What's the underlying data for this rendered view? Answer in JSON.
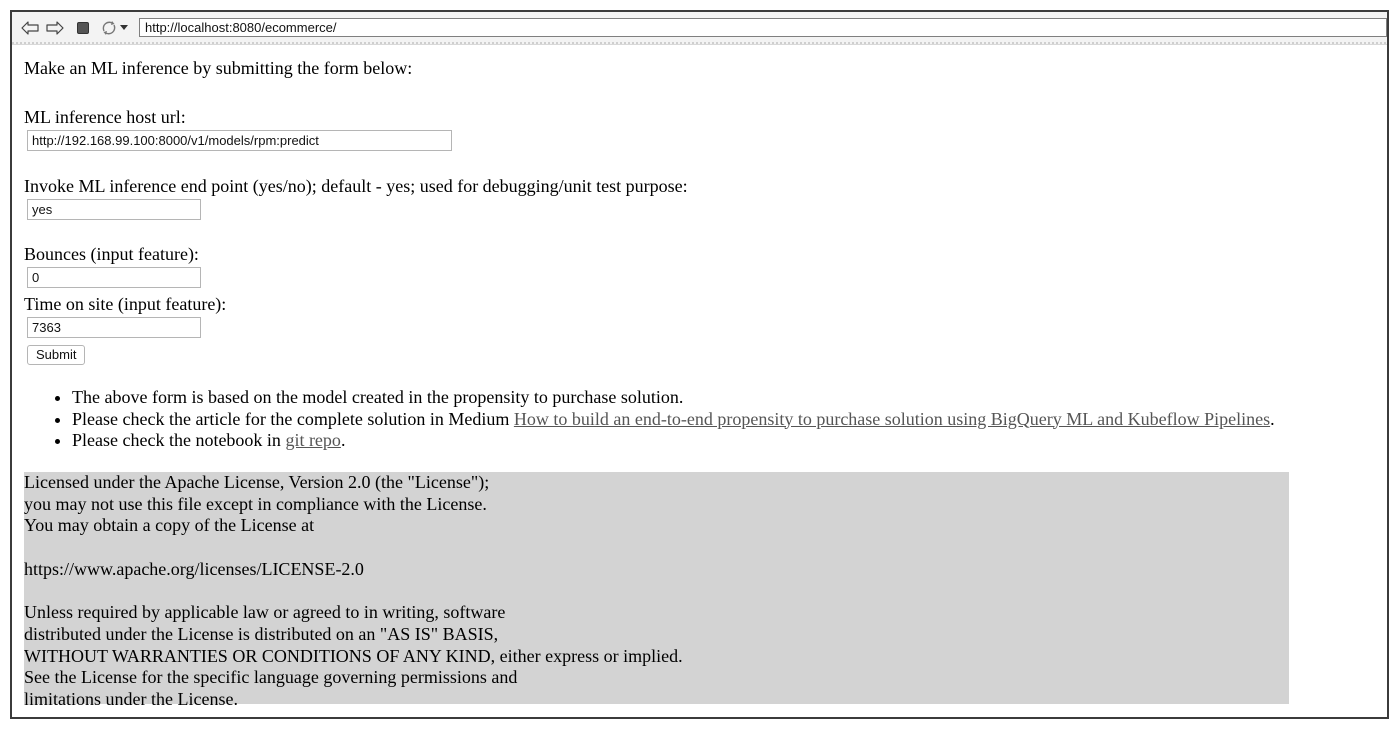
{
  "browser": {
    "url": "http://localhost:8080/ecommerce/",
    "icons": [
      "back-arrow-icon",
      "forward-arrow-icon",
      "stop-icon",
      "reload-icon",
      "chevron-down-icon"
    ]
  },
  "form": {
    "intro": "Make an ML inference by submitting the form below:",
    "host_label": "ML inference host url:",
    "host_value": "http://192.168.99.100:8000/v1/models/rpm:predict",
    "invoke_label": "Invoke ML inference end point (yes/no); default - yes; used for debugging/unit test purpose:",
    "invoke_value": "yes",
    "bounces_label": "Bounces (input feature):",
    "bounces_value": "0",
    "time_label": "Time on site (input feature):",
    "time_value": "7363",
    "submit_label": "Submit"
  },
  "notes": {
    "item1": "The above form is based on the model created in the propensity to purchase solution.",
    "item2_prefix": "Please check the article for the complete solution in Medium ",
    "item2_link": "How to build an end-to-end propensity to purchase solution using BigQuery ML and Kubeflow Pipelines",
    "item2_suffix": ".",
    "item3_prefix": "Please check the notebook in ",
    "item3_link": "git repo",
    "item3_suffix": "."
  },
  "license": {
    "l1": "Licensed under the Apache License, Version 2.0 (the \"License\");",
    "l2": "you may not use this file except in compliance with the License.",
    "l3": "You may obtain a copy of the License at",
    "l4": "https://www.apache.org/licenses/LICENSE-2.0",
    "l5": "Unless required by applicable law or agreed to in writing, software",
    "l6": "distributed under the License is distributed on an \"AS IS\" BASIS,",
    "l7": "WITHOUT WARRANTIES OR CONDITIONS OF ANY KIND, either express or implied.",
    "l8": "See the License for the specific language governing permissions and",
    "l9": "limitations under the License."
  }
}
